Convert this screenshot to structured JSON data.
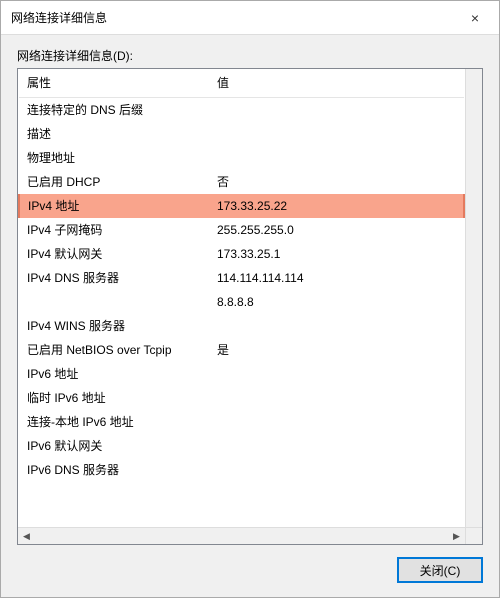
{
  "window": {
    "title": "网络连接详细信息",
    "close_icon": "×"
  },
  "content": {
    "list_label": "网络连接详细信息(D):",
    "columns": {
      "property": "属性",
      "value": "值"
    },
    "rows": [
      {
        "prop": "连接特定的 DNS 后缀",
        "val": ""
      },
      {
        "prop": "描述",
        "val": ""
      },
      {
        "prop": "物理地址",
        "val": ""
      },
      {
        "prop": "已启用 DHCP",
        "val": "否"
      },
      {
        "prop": "IPv4 地址",
        "val": "173.33.25.22",
        "highlight": true
      },
      {
        "prop": "IPv4 子网掩码",
        "val": "255.255.255.0"
      },
      {
        "prop": "IPv4 默认网关",
        "val": "173.33.25.1"
      },
      {
        "prop": "IPv4 DNS 服务器",
        "val": "114.114.114.114"
      },
      {
        "prop": "",
        "val": "8.8.8.8"
      },
      {
        "prop": "IPv4 WINS 服务器",
        "val": ""
      },
      {
        "prop": "已启用 NetBIOS over Tcpip",
        "val": "是"
      },
      {
        "prop": "IPv6 地址",
        "val": ""
      },
      {
        "prop": "临时 IPv6 地址",
        "val": ""
      },
      {
        "prop": "连接-本地 IPv6 地址",
        "val": ""
      },
      {
        "prop": "IPv6 默认网关",
        "val": ""
      },
      {
        "prop": "IPv6 DNS 服务器",
        "val": ""
      }
    ]
  },
  "buttons": {
    "close": "关闭(C)"
  },
  "scroll": {
    "left_arrow": "◀",
    "right_arrow": "▶"
  }
}
